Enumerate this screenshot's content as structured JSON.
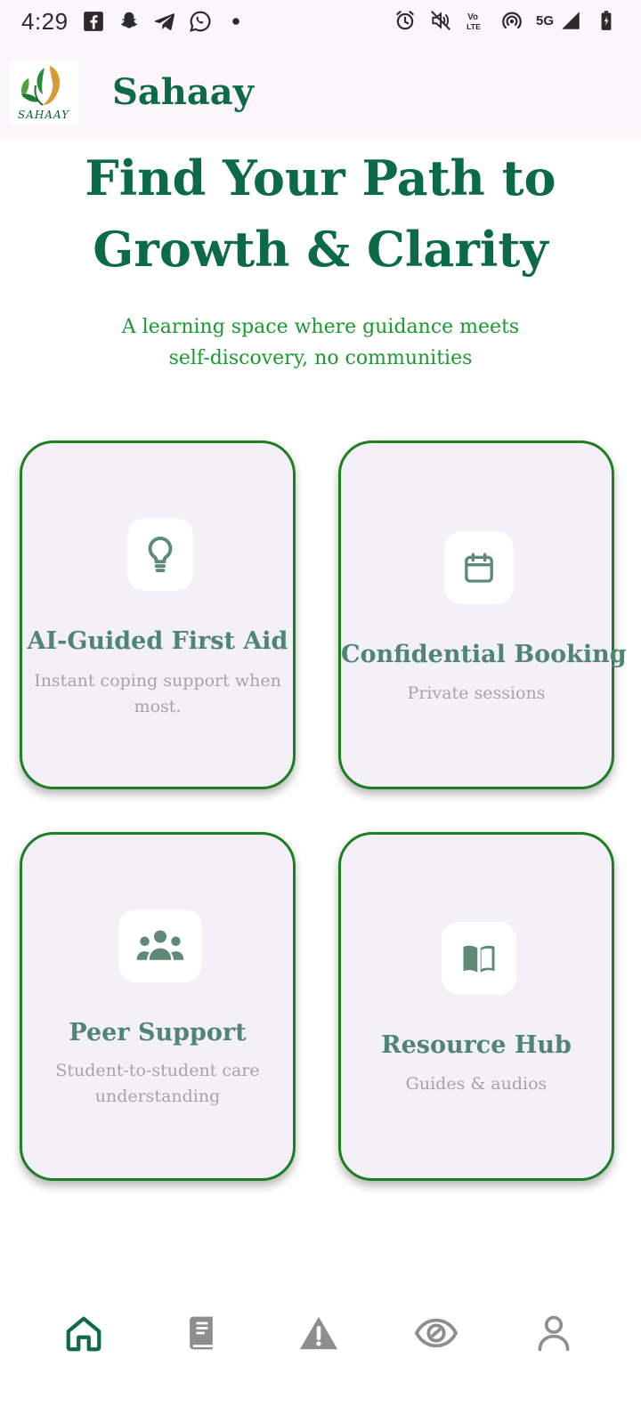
{
  "status_bar": {
    "time": "4:29",
    "network": "5G",
    "left_icons": [
      "facebook-icon",
      "snapchat-icon",
      "telegram-icon",
      "whatsapp-icon",
      "dot-icon"
    ],
    "right_icons": [
      "alarm-icon",
      "mute-icon",
      "volte-icon",
      "hotspot-icon",
      "signal-icon",
      "battery-icon"
    ]
  },
  "app_bar": {
    "title": "Sahaay",
    "logo_text": "SAHAAY"
  },
  "hero": {
    "title_line1": "Find Your Path to",
    "title_line2": "Growth & Clarity",
    "subtitle_line1": "A learning space where guidance meets",
    "subtitle_line2": "self-discovery, no communities"
  },
  "cards": [
    {
      "title": "AI-Guided First Aid",
      "desc_line1": "Instant coping support when",
      "desc_line2": "most.",
      "icon": "lightbulb-icon"
    },
    {
      "title": "Confidential Booking",
      "desc_line1": "Private sessions",
      "desc_line2": "",
      "icon": "calendar-icon"
    },
    {
      "title": "Peer Support",
      "desc_line1": "Student-to-student care",
      "desc_line2": "understanding",
      "icon": "group-icon"
    },
    {
      "title": "Resource Hub",
      "desc_line1": "Guides & audios",
      "desc_line2": "",
      "icon": "book-icon"
    }
  ],
  "bottom_nav": {
    "items": [
      "home-icon",
      "journal-icon",
      "alert-icon",
      "eye-icon",
      "profile-icon"
    ],
    "active": "home-icon"
  },
  "colors": {
    "brand_green": "#0c6b47",
    "card_border": "#1e7f22",
    "subtitle_green": "#1a9a2e",
    "icon_green": "#5e8a76",
    "nav_inactive": "#8e8e8e"
  }
}
